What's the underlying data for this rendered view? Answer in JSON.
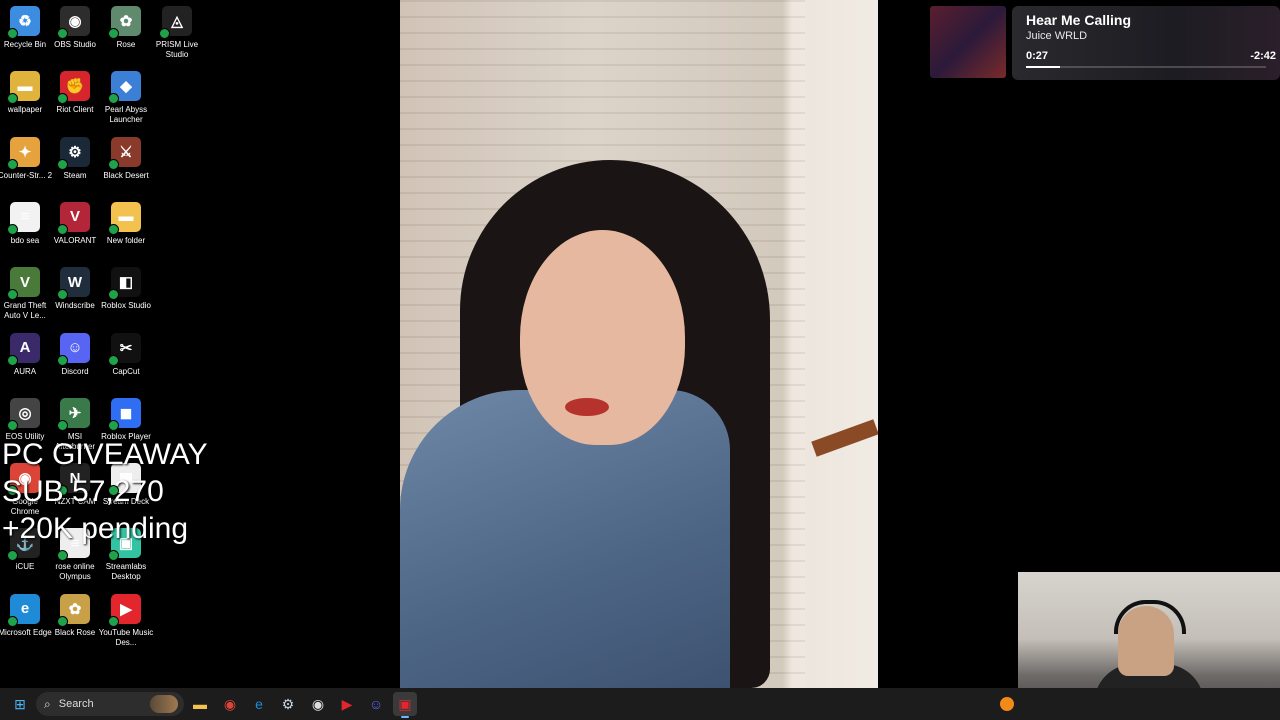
{
  "desktop": {
    "icons": [
      {
        "label": "Recycle Bin",
        "color": "#3c8de0",
        "glyph": "♻"
      },
      {
        "label": "OBS Studio",
        "color": "#2d2d2d",
        "glyph": "◉"
      },
      {
        "label": "Rose",
        "color": "#5f8a6e",
        "glyph": "✿"
      },
      {
        "label": "PRISM Live Studio",
        "color": "#222",
        "glyph": "◬"
      },
      {
        "label": "wallpaper",
        "color": "#e0b43c",
        "glyph": "▬"
      },
      {
        "label": "Riot Client",
        "color": "#d6252c",
        "glyph": "✊"
      },
      {
        "label": "Pearl Abyss Launcher",
        "color": "#3c7fd6",
        "glyph": "◆"
      },
      {
        "label": "Counter-Str... 2",
        "color": "#e6a23c",
        "glyph": "✦"
      },
      {
        "label": "Steam",
        "color": "#1b2838",
        "glyph": "⚙"
      },
      {
        "label": "Black Desert",
        "color": "#8a3a2a",
        "glyph": "⚔"
      },
      {
        "label": "bdo sea",
        "color": "#f2f2f2",
        "glyph": "≡"
      },
      {
        "label": "VALORANT",
        "color": "#b3263a",
        "glyph": "V"
      },
      {
        "label": "New folder",
        "color": "#f2c14e",
        "glyph": "▬"
      },
      {
        "label": "Grand Theft Auto V Le...",
        "color": "#4a7a3a",
        "glyph": "V"
      },
      {
        "label": "Windscribe",
        "color": "#1f2d3d",
        "glyph": "W"
      },
      {
        "label": "Roblox Studio",
        "color": "#111",
        "glyph": "◧"
      },
      {
        "label": "AURA",
        "color": "#3a2a6a",
        "glyph": "A"
      },
      {
        "label": "Discord",
        "color": "#5865f2",
        "glyph": "☺"
      },
      {
        "label": "CapCut",
        "color": "#111",
        "glyph": "✂"
      },
      {
        "label": "EOS Utility",
        "color": "#444",
        "glyph": "◎"
      },
      {
        "label": "MSI Afterburner",
        "color": "#3a7a4a",
        "glyph": "✈"
      },
      {
        "label": "Roblox Player",
        "color": "#2f6ef2",
        "glyph": "◼"
      },
      {
        "label": "Google Chrome",
        "color": "#db4437",
        "glyph": "◉"
      },
      {
        "label": "NZXT CAM",
        "color": "#222",
        "glyph": "N"
      },
      {
        "label": "Stream Deck",
        "color": "#eee",
        "glyph": "▦"
      },
      {
        "label": "iCUE",
        "color": "#222",
        "glyph": "⚓"
      },
      {
        "label": "rose online Olympus",
        "color": "#eee",
        "glyph": "≡"
      },
      {
        "label": "Streamlabs Desktop",
        "color": "#31c3a2",
        "glyph": "▣"
      },
      {
        "label": "Microsoft Edge",
        "color": "#1f8bd6",
        "glyph": "e"
      },
      {
        "label": "Black Rose",
        "color": "#c8a048",
        "glyph": "✿"
      },
      {
        "label": "YouTube Music Des...",
        "color": "#e3262d",
        "glyph": "▶"
      }
    ]
  },
  "overlay": {
    "line1": "PC GIVEAWAY",
    "line2": "SUB 57,270",
    "line3": "+20K pending"
  },
  "now_playing": {
    "title": "Hear Me Calling",
    "artist": "Juice WRLD",
    "elapsed": "0:27",
    "remaining": "-2:42",
    "progress": 0.14
  },
  "taskbar": {
    "search_placeholder": "Search",
    "apps": [
      {
        "name": "start-icon",
        "glyph": "⊞",
        "color": "#4fb3f6"
      },
      {
        "name": "file-explorer-icon",
        "glyph": "▬",
        "color": "#f2c14e"
      },
      {
        "name": "chrome-icon",
        "glyph": "◉",
        "color": "#db4437"
      },
      {
        "name": "edge-icon",
        "glyph": "e",
        "color": "#1f8bd6"
      },
      {
        "name": "steam-icon",
        "glyph": "⚙",
        "color": "#c7d5e0"
      },
      {
        "name": "obs-icon",
        "glyph": "◉",
        "color": "#ddd"
      },
      {
        "name": "youtube-music-icon",
        "glyph": "▶",
        "color": "#e3262d"
      },
      {
        "name": "discord-icon",
        "glyph": "☺",
        "color": "#5865f2"
      },
      {
        "name": "streaming-app-icon",
        "glyph": "▣",
        "color": "#e3262d"
      }
    ]
  }
}
